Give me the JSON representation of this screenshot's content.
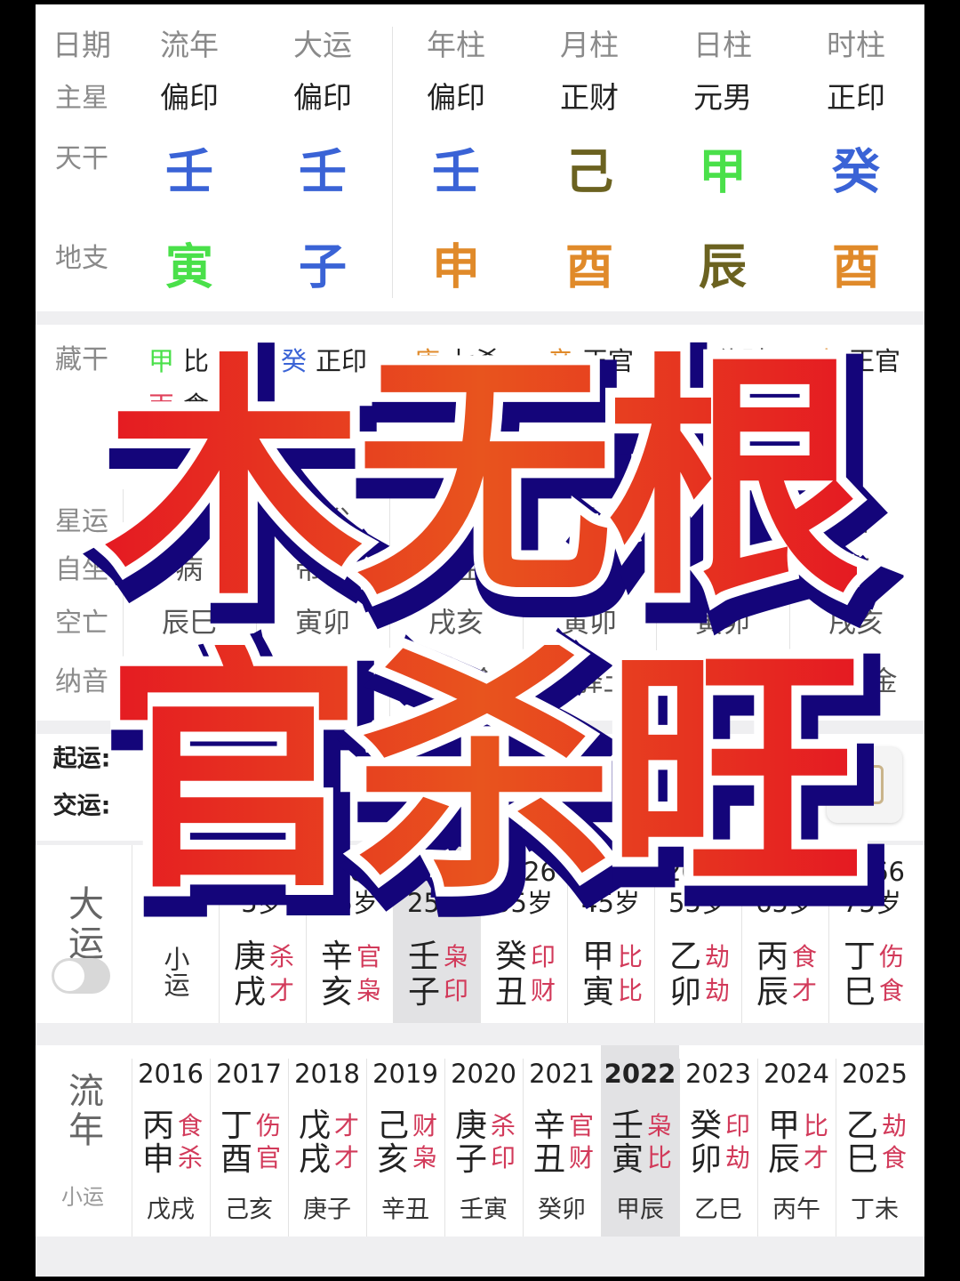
{
  "chart": {
    "header_labels": [
      "日期",
      "流年",
      "大运",
      "年柱",
      "月柱",
      "日柱",
      "时柱"
    ],
    "row_labels": {
      "main_star": "主星",
      "stem": "天干",
      "branch": "地支",
      "hidden": "藏干",
      "star_luck": "星运",
      "self_seat": "自坐",
      "void": "空亡",
      "nayin": "纳音"
    },
    "main_star": [
      "偏印",
      "偏印",
      "偏印",
      "正财",
      "元男",
      "正印"
    ],
    "stems": [
      {
        "c": "壬",
        "color": "#3a63d6"
      },
      {
        "c": "壬",
        "color": "#3a63d6"
      },
      {
        "c": "壬",
        "color": "#3a63d6"
      },
      {
        "c": "己",
        "color": "#6b6220"
      },
      {
        "c": "甲",
        "color": "#4ae04a"
      },
      {
        "c": "癸",
        "color": "#3a63d6"
      }
    ],
    "branches": [
      {
        "c": "寅",
        "color": "#4ae04a"
      },
      {
        "c": "子",
        "color": "#3a63d6"
      },
      {
        "c": "申",
        "color": "#e08a2a"
      },
      {
        "c": "酉",
        "color": "#e08a2a"
      },
      {
        "c": "辰",
        "color": "#6b6220"
      },
      {
        "c": "酉",
        "color": "#e08a2a"
      }
    ],
    "hidden": [
      [
        {
          "s": "甲",
          "t": "比肩",
          "color": "#4ae04a"
        },
        {
          "s": "丙",
          "t": "食神",
          "color": "#e0405a"
        }
      ],
      [
        {
          "s": "癸",
          "t": "正印",
          "color": "#3a63d6"
        }
      ],
      [
        {
          "s": "庚",
          "t": "七杀",
          "color": "#e08a2a"
        }
      ],
      [
        {
          "s": "辛",
          "t": "正官",
          "color": "#e08a2a"
        }
      ],
      [
        {
          "s": "戊",
          "t": "偏财",
          "color": "#6b6220"
        }
      ],
      [
        {
          "s": "辛",
          "t": "正官",
          "color": "#e08a2a"
        }
      ]
    ],
    "star_luck": [
      "临官",
      "沐浴",
      "绝",
      "胎",
      "衰",
      "胎"
    ],
    "self_seat": [
      "病",
      "帝旺",
      "长生",
      "长生",
      "衰",
      "病"
    ],
    "void": [
      "辰巳",
      "寅卯",
      "戌亥",
      "寅卯",
      "寅卯",
      "戌亥"
    ],
    "nayin": [
      "金箔金",
      "桑柘木",
      "剑锋金",
      "大驿土",
      "覆灯火",
      "剑锋金"
    ]
  },
  "luck_start": {
    "qiyun_label": "起运:",
    "jiaoyun_label": "交运:"
  },
  "dayun": {
    "label": "大运",
    "xiaoyun": "小运",
    "toggle_on": false,
    "columns": [
      {
        "year": "1996",
        "age": "5岁",
        "s": "庚",
        "st": "杀",
        "b": "戌",
        "bt": "才"
      },
      {
        "year": "2006",
        "age": "15岁",
        "s": "辛",
        "st": "官",
        "b": "亥",
        "bt": "枭"
      },
      {
        "year": "2016",
        "age": "25岁",
        "s": "壬",
        "st": "枭",
        "b": "子",
        "bt": "印",
        "current": true
      },
      {
        "year": "2026",
        "age": "35岁",
        "s": "癸",
        "st": "印",
        "b": "丑",
        "bt": "财"
      },
      {
        "year": "2036",
        "age": "45岁",
        "s": "甲",
        "st": "比",
        "b": "寅",
        "bt": "比"
      },
      {
        "year": "2046",
        "age": "55岁",
        "s": "乙",
        "st": "劫",
        "b": "卯",
        "bt": "劫"
      },
      {
        "year": "2056",
        "age": "65岁",
        "s": "丙",
        "st": "食",
        "b": "辰",
        "bt": "才"
      },
      {
        "year": "2066",
        "age": "75岁",
        "s": "丁",
        "st": "伤",
        "b": "巳",
        "bt": "食"
      }
    ]
  },
  "liunian": {
    "label": "流年",
    "xiaoyun_label": "小运",
    "columns": [
      {
        "year": "2016",
        "s": "丙",
        "st": "食",
        "b": "申",
        "bt": "杀",
        "x": "戊戌"
      },
      {
        "year": "2017",
        "s": "丁",
        "st": "伤",
        "b": "酉",
        "bt": "官",
        "x": "己亥"
      },
      {
        "year": "2018",
        "s": "戊",
        "st": "才",
        "b": "戌",
        "bt": "才",
        "x": "庚子"
      },
      {
        "year": "2019",
        "s": "己",
        "st": "财",
        "b": "亥",
        "bt": "枭",
        "x": "辛丑"
      },
      {
        "year": "2020",
        "s": "庚",
        "st": "杀",
        "b": "子",
        "bt": "印",
        "x": "壬寅"
      },
      {
        "year": "2021",
        "s": "辛",
        "st": "官",
        "b": "丑",
        "bt": "财",
        "x": "癸卯"
      },
      {
        "year": "2022",
        "s": "壬",
        "st": "枭",
        "b": "寅",
        "bt": "比",
        "x": "甲辰",
        "current": true
      },
      {
        "year": "2023",
        "s": "癸",
        "st": "印",
        "b": "卯",
        "bt": "劫",
        "x": "乙巳"
      },
      {
        "year": "2024",
        "s": "甲",
        "st": "比",
        "b": "辰",
        "bt": "才",
        "x": "丙午"
      },
      {
        "year": "2025",
        "s": "乙",
        "st": "劫",
        "b": "巳",
        "bt": "食",
        "x": "丁未"
      }
    ]
  },
  "overlay": {
    "line1": "木无根",
    "line2": "官杀旺"
  },
  "icons": {
    "today": "calendar-today-icon"
  }
}
